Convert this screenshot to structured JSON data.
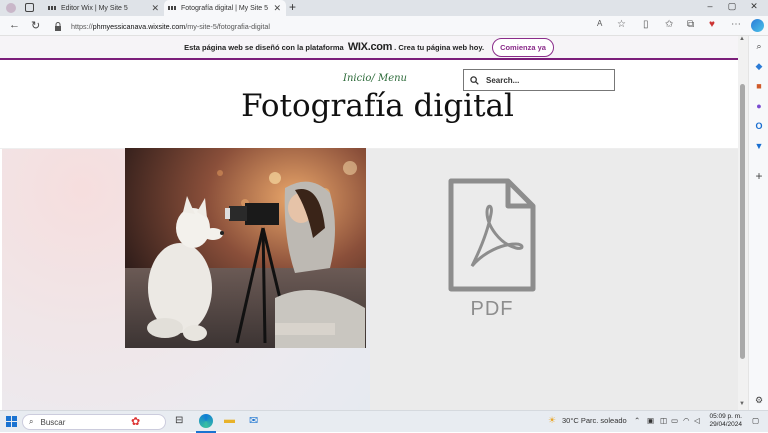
{
  "browser": {
    "tabs": [
      {
        "title": "Editor Wix | My Site 5",
        "active": false
      },
      {
        "title": "Fotografía digital | My Site 5",
        "active": true
      }
    ],
    "url_prefix": "https://",
    "url_domain": "phmyessicanava.wixsite.com",
    "url_path": "/my-site-5/fotografia-digital"
  },
  "wix_banner": {
    "text_before": "Esta página web se diseñó con la plataforma",
    "brand": "WIX.com",
    "text_after": ". Crea tu página web hoy.",
    "cta": "Comienza ya"
  },
  "site": {
    "menu_text": "Inicio/ Menu",
    "search_placeholder": "Search...",
    "title": "Fotografía digital",
    "pdf_label": "PDF"
  },
  "taskbar": {
    "search_placeholder": "Buscar",
    "weather": "30°C  Parc. soleado",
    "time": "05:09 p. m.",
    "date": "29/04/2024"
  },
  "colors": {
    "accent": "#7b1e7a",
    "menu_green": "#2d6b3a",
    "pdf_gray": "#8d8d8d"
  }
}
